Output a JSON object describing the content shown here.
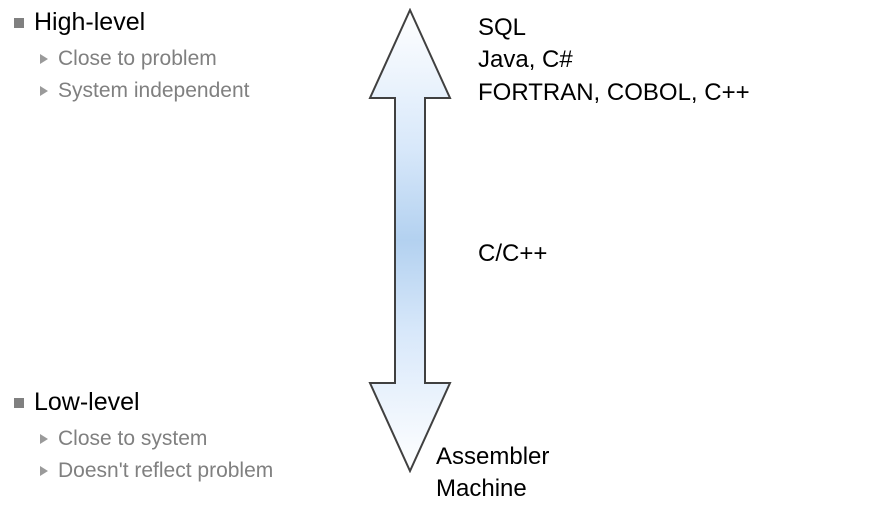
{
  "left": {
    "high_level": {
      "title": "High-level",
      "items": [
        "Close to problem",
        "System independent"
      ]
    },
    "low_level": {
      "title": "Low-level",
      "items": [
        "Close to system",
        "Doesn't reflect problem"
      ]
    }
  },
  "right": {
    "top": [
      "SQL",
      "Java, C#",
      "FORTRAN, COBOL, C++"
    ],
    "middle": "C/C++",
    "bottom": [
      "Assembler",
      "Machine"
    ]
  }
}
